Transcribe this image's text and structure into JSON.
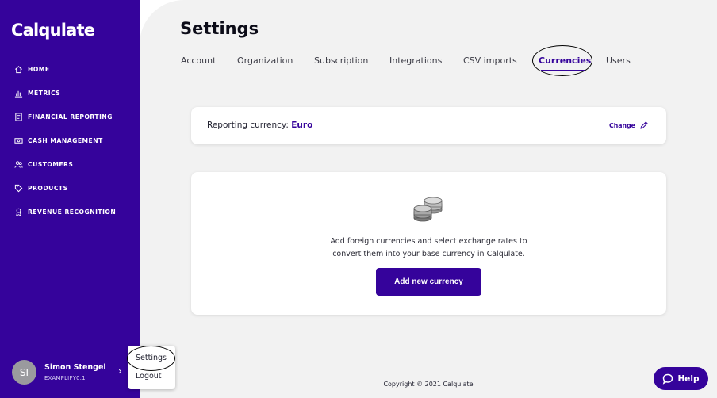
{
  "app": {
    "name": "Calqulate"
  },
  "sidebar": {
    "items": [
      {
        "label": "HOME",
        "icon": "home-icon"
      },
      {
        "label": "METRICS",
        "icon": "metrics-icon"
      },
      {
        "label": "FINANCIAL REPORTING",
        "icon": "report-icon"
      },
      {
        "label": "CASH MANAGEMENT",
        "icon": "cash-icon"
      },
      {
        "label": "CUSTOMERS",
        "icon": "customers-icon"
      },
      {
        "label": "PRODUCTS",
        "icon": "tag-icon"
      },
      {
        "label": "REVENUE RECOGNITION",
        "icon": "revenue-icon"
      }
    ]
  },
  "user": {
    "initials": "SI",
    "name": "Simon Stengel",
    "org": "EXAMPLIFY0.1"
  },
  "user_menu": {
    "settings": "Settings",
    "logout": "Logout"
  },
  "page": {
    "title": "Settings"
  },
  "tabs": [
    {
      "label": "Account"
    },
    {
      "label": "Organization"
    },
    {
      "label": "Subscription"
    },
    {
      "label": "Integrations"
    },
    {
      "label": "CSV imports"
    },
    {
      "label": "Currencies",
      "active": true
    },
    {
      "label": "Users"
    }
  ],
  "reporting": {
    "label": "Reporting currency:",
    "value": "Euro",
    "change_label": "Change"
  },
  "empty_state": {
    "line1": "Add foreign currencies and select exchange rates to",
    "line2": "convert them into your base currency in Calqulate.",
    "button_label": "Add new currency"
  },
  "footer": {
    "copyright": "Copyright © 2021 Calqulate"
  },
  "help": {
    "label": "Help"
  },
  "colors": {
    "brand": "#35039b",
    "background": "#f2f2f2",
    "avatar": "#9a9a9e"
  }
}
